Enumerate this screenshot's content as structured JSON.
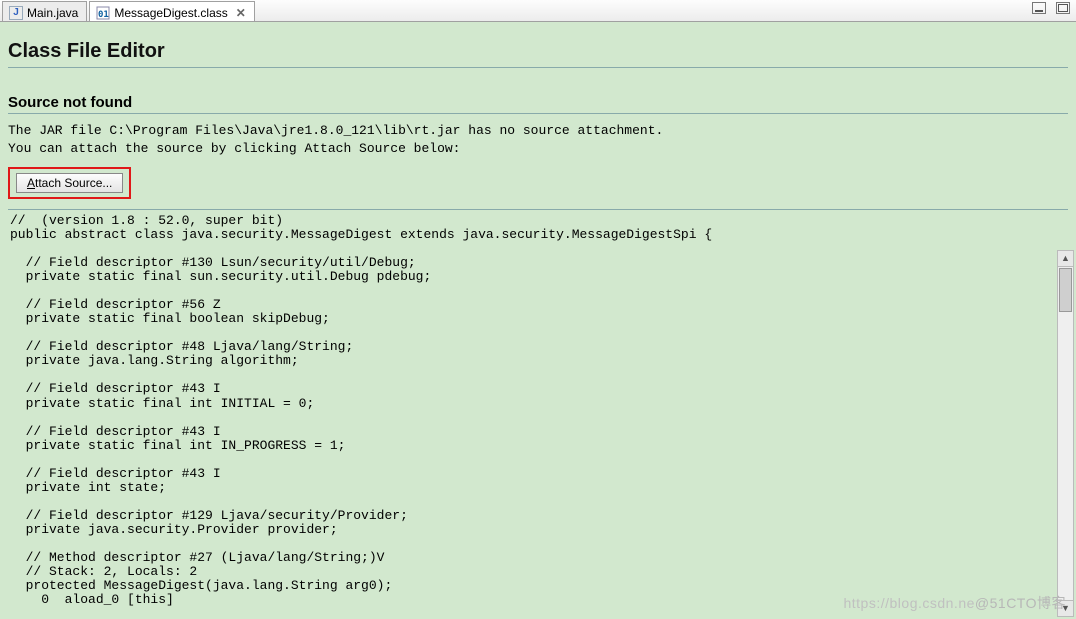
{
  "tabs": [
    {
      "icon": "J",
      "label": "Main.java"
    },
    {
      "icon": "c",
      "label": "MessageDigest.class"
    }
  ],
  "title": "Class File Editor",
  "subtitle": "Source not found",
  "msg1": "The JAR file C:\\Program Files\\Java\\jre1.8.0_121\\lib\\rt.jar has no source attachment.",
  "msg2": "You can attach the source by clicking Attach Source below:",
  "attach_prefix": "A",
  "attach_rest": "ttach Source...",
  "code": "//  (version 1.8 : 52.0, super bit)\npublic abstract class java.security.MessageDigest extends java.security.MessageDigestSpi {\n  \n  // Field descriptor #130 Lsun/security/util/Debug;\n  private static final sun.security.util.Debug pdebug;\n  \n  // Field descriptor #56 Z\n  private static final boolean skipDebug;\n  \n  // Field descriptor #48 Ljava/lang/String;\n  private java.lang.String algorithm;\n  \n  // Field descriptor #43 I\n  private static final int INITIAL = 0;\n  \n  // Field descriptor #43 I\n  private static final int IN_PROGRESS = 1;\n  \n  // Field descriptor #43 I\n  private int state;\n  \n  // Field descriptor #129 Ljava/security/Provider;\n  private java.security.Provider provider;\n  \n  // Method descriptor #27 (Ljava/lang/String;)V\n  // Stack: 2, Locals: 2\n  protected MessageDigest(java.lang.String arg0);\n    0  aload_0 [this]",
  "watermark_left": "https://blog.csdn.ne",
  "watermark_right": "@51CTO博客"
}
